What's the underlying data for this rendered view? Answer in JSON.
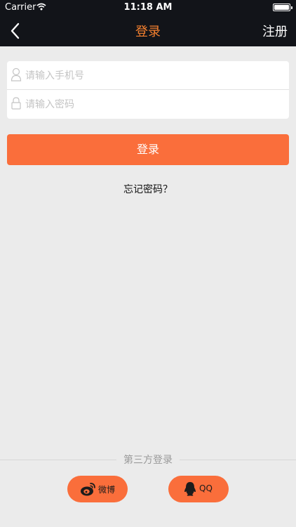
{
  "status_bar": {
    "carrier": "Carrier",
    "time": "11:18 AM",
    "battery_level": 1.0
  },
  "nav": {
    "title": "登录",
    "right_action": "注册",
    "back_icon": "chevron-left-icon",
    "title_color": "#f4802f",
    "bar_color": "#121419"
  },
  "form": {
    "phone_placeholder": "请输入手机号",
    "phone_value": "",
    "phone_icon": "user-icon",
    "password_placeholder": "请输入密码",
    "password_value": "",
    "password_icon": "lock-icon"
  },
  "login_button": {
    "label": "登录",
    "color": "#fa6e3b"
  },
  "forgot_password": "忘记密码？",
  "third_party": {
    "label": "第三方登录",
    "providers": [
      {
        "label": "微博",
        "icon": "weibo-icon"
      },
      {
        "label": "QQ",
        "icon": "qq-icon"
      }
    ]
  }
}
